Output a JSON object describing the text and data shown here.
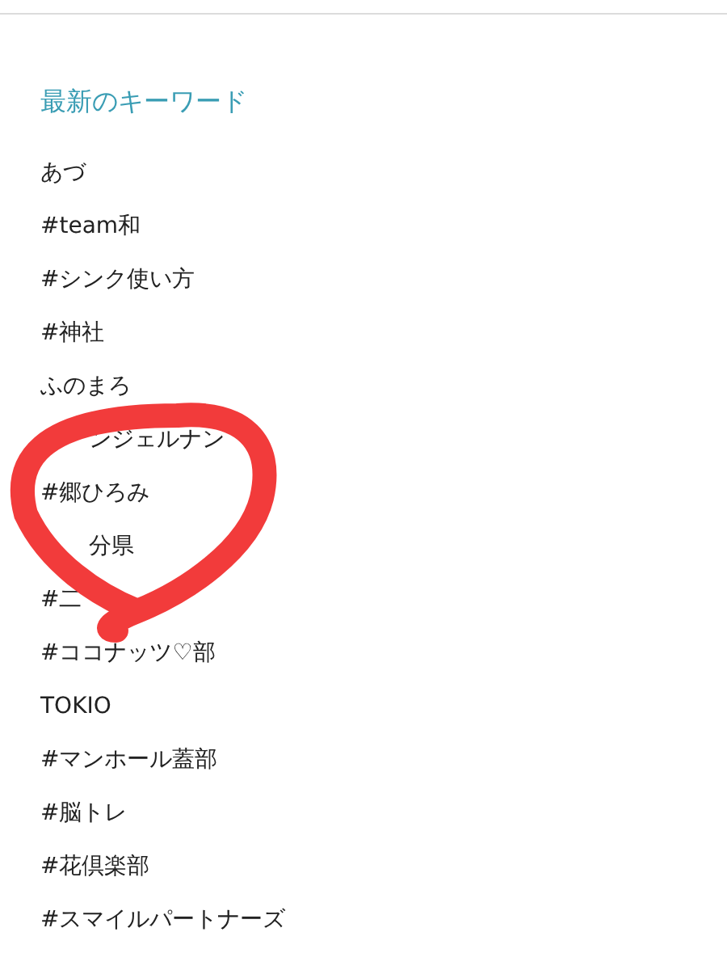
{
  "section": {
    "title": "最新のキーワード"
  },
  "keywords": [
    {
      "text": "あづ",
      "kind": "full"
    },
    {
      "text": "#team和",
      "kind": "full"
    },
    {
      "text": "#シンク使い方",
      "kind": "full"
    },
    {
      "text": "#神社",
      "kind": "full"
    },
    {
      "text": "ふのまろ",
      "kind": "full"
    },
    {
      "text": "ンジェルナン",
      "kind": "tail"
    },
    {
      "text": "#郷ひろみ",
      "kind": "full"
    },
    {
      "text": "分県",
      "kind": "tail"
    },
    {
      "text": "#二",
      "kind": "full"
    },
    {
      "text": "#ココナッツ♡部",
      "kind": "full"
    },
    {
      "text": "TOKIO",
      "kind": "full"
    },
    {
      "text": "#マンホール蓋部",
      "kind": "full"
    },
    {
      "text": "#脳トレ",
      "kind": "full"
    },
    {
      "text": "#花倶楽部",
      "kind": "full"
    },
    {
      "text": "#スマイルパートナーズ",
      "kind": "full"
    }
  ]
}
